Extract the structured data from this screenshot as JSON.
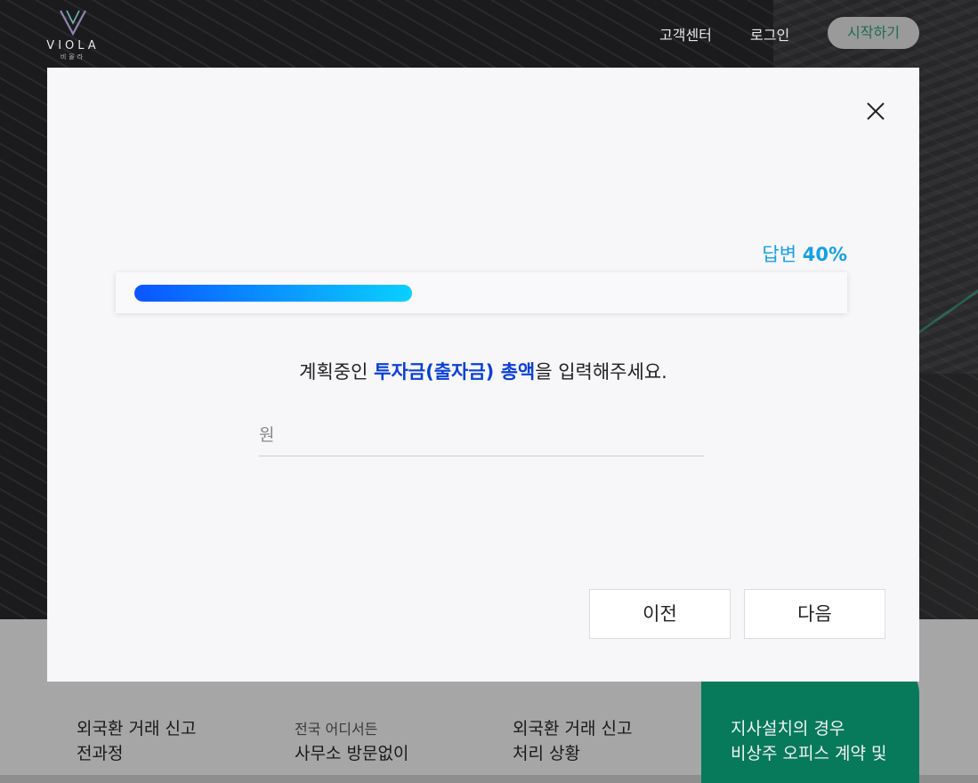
{
  "header": {
    "logo_word": "VIOLA",
    "logo_sub": "비올라",
    "nav": [
      "고객센터",
      "로그인"
    ],
    "start_label": "시작하기"
  },
  "modal": {
    "progress_prefix": "답변",
    "progress_pct_text": "40%",
    "progress_value": 0.4,
    "question_pre": "계획중인 ",
    "question_highlight": "투자금(출자금) 총액",
    "question_post": "을 입력해주세요.",
    "input_placeholder": "원",
    "input_value": "",
    "prev_label": "이전",
    "next_label": "다음",
    "close_icon": "close-icon"
  },
  "background_text": {
    "col1": [
      "외국환 거래 신고",
      "전과정"
    ],
    "col2_small": "전국 어디서든",
    "col2": [
      "사무소 방문없이"
    ],
    "col3": [
      "외국환 거래 신고",
      "처리 상황"
    ],
    "col4": [
      "지사설치의 경우",
      "비상주 오피스 계약 및"
    ]
  },
  "colors": {
    "accent": "#16a0e6",
    "highlight": "#0b3fd8",
    "progress_start": "#0a55ff",
    "progress_end": "#0ad0ff",
    "green": "#067a5b"
  }
}
